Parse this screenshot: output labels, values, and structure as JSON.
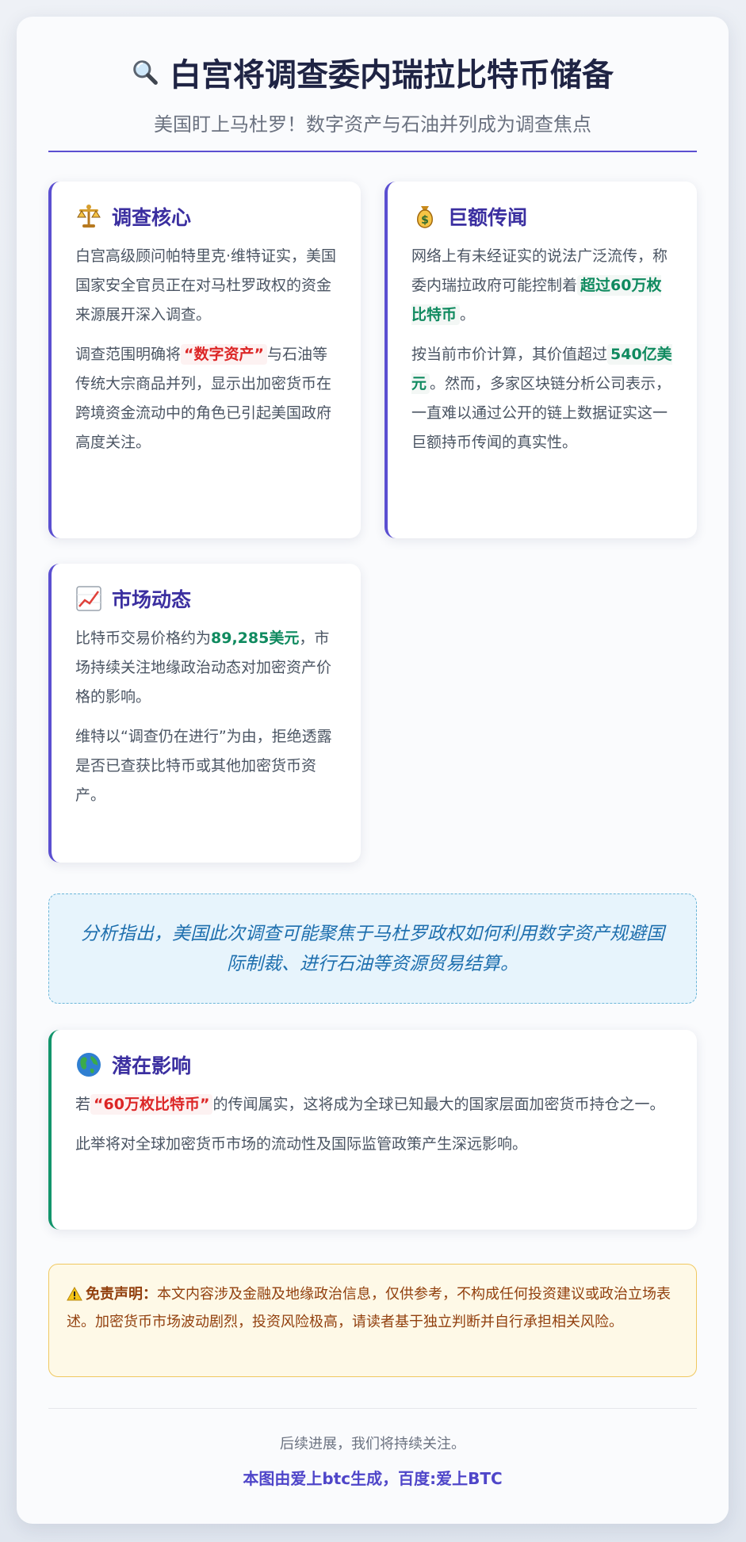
{
  "header": {
    "title": "白宫将调查委内瑞拉比特币储备",
    "subtitle": "美国盯上马杜罗！数字资产与石油并列成为调查焦点",
    "title_icon": "magnifier-icon"
  },
  "cards": {
    "core": {
      "icon": "scales-icon",
      "title": "调查核心",
      "p1": "白宫高级顾问帕特里克·维特证实，美国国家安全官员正在对马杜罗政权的资金来源展开深入调查。",
      "p2_pre": "调查范围明确将",
      "p2_hl": "“数字资产”",
      "p2_post": "与石油等传统大宗商品并列，显示出加密货币在跨境资金流动中的角色已引起美国政府高度关注。"
    },
    "rumor": {
      "icon": "money-bag-icon",
      "title": "巨额传闻",
      "p1_pre": "网络上有未经证实的说法广泛流传，称委内瑞拉政府可能控制着",
      "p1_hl": "超过60万枚比特币",
      "p1_post": "。",
      "p2_pre": "按当前市价计算，其价值超过",
      "p2_hl": "540亿美元",
      "p2_post": "。然而，多家区块链分析公司表示，一直难以通过公开的链上数据证实这一巨额持币传闻的真实性。"
    },
    "market": {
      "icon": "chart-up-icon",
      "title": "市场动态",
      "p1_pre": "比特币交易价格约为",
      "p1_hl": "89,285美元",
      "p1_post": "，市场持续关注地缘政治动态对加密资产价格的影响。",
      "p2": "维特以“调查仍在进行”为由，拒绝透露是否已查获比特币或其他加密货币资产。"
    },
    "impact": {
      "icon": "globe-icon",
      "title": "潜在影响",
      "p1_pre": "若",
      "p1_hl": "“60万枚比特币”",
      "p1_post": "的传闻属实，这将成为全球已知最大的国家层面加密货币持仓之一。",
      "p2": "此举将对全球加密货币市场的流动性及国际监管政策产生深远影响。"
    }
  },
  "quote": "分析指出，美国此次调查可能聚焦于马杜罗政权如何利用数字资产规避国际制裁、进行石油等资源贸易结算。",
  "disclaimer": {
    "icon": "warning-icon",
    "label": "免责声明：",
    "text": "本文内容涉及金融及地缘政治信息，仅供参考，不构成任何投资建议或政治立场表述。加密货币市场波动剧烈，投资风险极高，请读者基于独立判断并自行承担相关风险。"
  },
  "footer": {
    "note": "后续进展，我们将持续关注。",
    "credit": "本图由爱上btc生成，百度:爱上BTC"
  },
  "colors": {
    "accent": "#5b4fd1",
    "green": "#12956b",
    "red": "#dc2626",
    "quote_text": "#1e6fae",
    "disclaimer_text": "#92400e"
  }
}
